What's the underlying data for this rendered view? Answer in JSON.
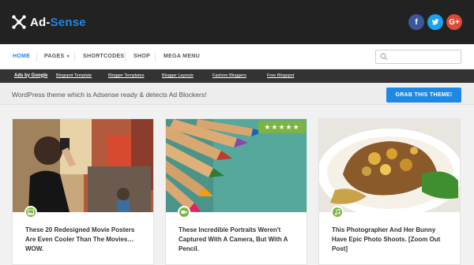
{
  "header": {
    "logo_main": "Ad-",
    "logo_accent": "Sense",
    "social": [
      {
        "icon": "facebook-icon",
        "glyph": "f"
      },
      {
        "icon": "twitter-icon",
        "glyph": "t"
      },
      {
        "icon": "google-plus-icon",
        "glyph": "G+"
      }
    ]
  },
  "nav": {
    "items": [
      "HOME",
      "PAGES",
      "SHORTCODES",
      "SHOP",
      "MEGA MENU"
    ],
    "active": "HOME",
    "search_placeholder": ""
  },
  "links": {
    "brand": "Ads by Google",
    "items": [
      "Blogspot Template",
      "Blogger Templates",
      "Blogger Layouts",
      "Fashion Bloggers",
      "Free Blogspot"
    ]
  },
  "promo": {
    "text": "WordPress theme which is Adsense ready & detects Ad Blockers!",
    "button": "GRAB THIS THEME!"
  },
  "cards": [
    {
      "title": "These 20 Redesigned Movie Posters Are Even Cooler Than The Movies… WOW.",
      "badge_icon": "image-icon"
    },
    {
      "title": "These Incredible Portraits Weren't Captured With A Camera, But With A Pencil.",
      "badge_icon": "video-icon",
      "rating": "★★★★★"
    },
    {
      "title": "This Photographer And Her Bunny Have Epic Photo Shoots. [Zoom Out Post]",
      "badge_icon": "music-icon"
    }
  ],
  "colors": {
    "accent": "#1e88e5",
    "badge": "#7cb342",
    "header_bg": "#222222"
  }
}
